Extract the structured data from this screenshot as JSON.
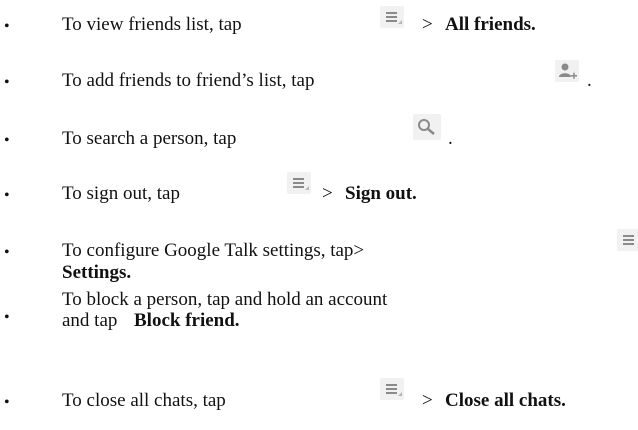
{
  "items": [
    {
      "bullet": "•",
      "text": "To view friends list, tap",
      "icon": "menu-icon",
      "after_prefix": "> ",
      "after_bold": "All friends."
    },
    {
      "bullet": "•",
      "text": "To add friends to friend’s list, tap",
      "icon": "add-person-icon",
      "after_prefix": "",
      "after_bold": "",
      "period": "."
    },
    {
      "bullet": "•",
      "text": "To search a person, tap",
      "icon": "search-icon",
      "after_prefix": "",
      "after_bold": "",
      "period": "."
    },
    {
      "bullet": "•",
      "text": "To sign out, tap",
      "icon": "menu-icon",
      "after_prefix": "> ",
      "after_bold": "Sign out."
    },
    {
      "bullet": "•",
      "text": "To configure Google Talk settings, tap>",
      "icon": "menu-icon",
      "after_prefix": "",
      "after_bold": "Settings."
    },
    {
      "bullet": "•",
      "line1": "To block a person, tap and hold an account",
      "line2_prefix": "and tap ",
      "line2_bold": "Block friend."
    },
    {
      "bullet": "•",
      "text": "To close all chats, tap",
      "icon": "menu-icon",
      "after_prefix": "> ",
      "after_bold": "Close all chats."
    }
  ],
  "colors": {
    "icon_bg": "#f1f1f1",
    "icon_fg": "#8a8a8a",
    "text": "#111111"
  }
}
